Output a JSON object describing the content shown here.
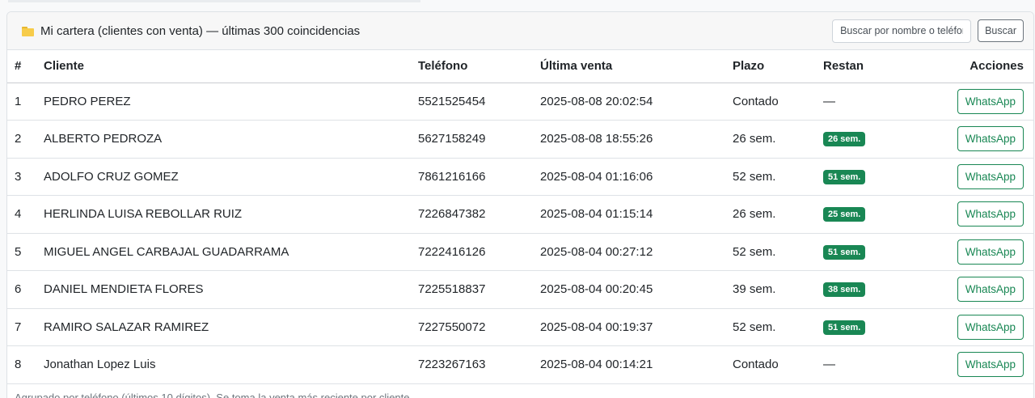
{
  "header": {
    "icon": "folder-icon",
    "title": "Mi cartera (clientes con venta) — últimas 300 coincidencias",
    "search_placeholder": "Buscar por nombre o teléfono",
    "search_button": "Buscar"
  },
  "table": {
    "columns": {
      "num": "#",
      "client": "Cliente",
      "phone": "Teléfono",
      "last_sale": "Última venta",
      "term": "Plazo",
      "remaining": "Restan",
      "actions": "Acciones"
    },
    "rows": [
      {
        "num": "1",
        "client": "PEDRO PEREZ",
        "phone": "5521525454",
        "last_sale": "2025-08-08 20:02:54",
        "term": "Contado",
        "remaining": "—",
        "remaining_badge": false,
        "action": "WhatsApp"
      },
      {
        "num": "2",
        "client": "ALBERTO PEDROZA",
        "phone": "5627158249",
        "last_sale": "2025-08-08 18:55:26",
        "term": "26 sem.",
        "remaining": "26 sem.",
        "remaining_badge": true,
        "action": "WhatsApp"
      },
      {
        "num": "3",
        "client": "ADOLFO CRUZ GOMEZ",
        "phone": "7861216166",
        "last_sale": "2025-08-04 01:16:06",
        "term": "52 sem.",
        "remaining": "51 sem.",
        "remaining_badge": true,
        "action": "WhatsApp"
      },
      {
        "num": "4",
        "client": "HERLINDA LUISA REBOLLAR RUIZ",
        "phone": "7226847382",
        "last_sale": "2025-08-04 01:15:14",
        "term": "26 sem.",
        "remaining": "25 sem.",
        "remaining_badge": true,
        "action": "WhatsApp"
      },
      {
        "num": "5",
        "client": "MIGUEL ANGEL CARBAJAL GUADARRAMA",
        "phone": "7222416126",
        "last_sale": "2025-08-04 00:27:12",
        "term": "52 sem.",
        "remaining": "51 sem.",
        "remaining_badge": true,
        "action": "WhatsApp"
      },
      {
        "num": "6",
        "client": "DANIEL MENDIETA FLORES",
        "phone": "7225518837",
        "last_sale": "2025-08-04 00:20:45",
        "term": "39 sem.",
        "remaining": "38 sem.",
        "remaining_badge": true,
        "action": "WhatsApp"
      },
      {
        "num": "7",
        "client": "RAMIRO SALAZAR RAMIREZ",
        "phone": "7227550072",
        "last_sale": "2025-08-04 00:19:37",
        "term": "52 sem.",
        "remaining": "51 sem.",
        "remaining_badge": true,
        "action": "WhatsApp"
      },
      {
        "num": "8",
        "client": "Jonathan Lopez Luis",
        "phone": "7223267163",
        "last_sale": "2025-08-04 00:14:21",
        "term": "Contado",
        "remaining": "—",
        "remaining_badge": false,
        "action": "WhatsApp"
      }
    ]
  },
  "footer": {
    "note": "Agrupado por teléfono (últimos 10 dígitos). Se toma la venta más reciente por cliente."
  },
  "colors": {
    "badge": "#198754",
    "whatsapp_outline": "#198754",
    "folder": "#f7cc4a"
  }
}
